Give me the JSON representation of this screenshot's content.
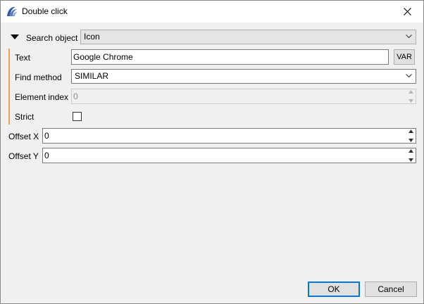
{
  "window": {
    "title": "Double click",
    "icon": "app-logo-icon",
    "close_icon": "close-icon"
  },
  "search_object": {
    "label": "Search object",
    "value": "Icon",
    "toggle_icon": "triangle-down-icon"
  },
  "fields": {
    "text": {
      "label": "Text",
      "value": "Google Chrome",
      "var_label": "VAR"
    },
    "find_method": {
      "label": "Find method",
      "value": "SIMILAR"
    },
    "element_index": {
      "label": "Element index",
      "value": "0"
    },
    "strict": {
      "label": "Strict",
      "checked": false
    }
  },
  "offsets": {
    "x": {
      "label": "Offset X",
      "value": "0"
    },
    "y": {
      "label": "Offset Y",
      "value": "0"
    }
  },
  "buttons": {
    "ok": "OK",
    "cancel": "Cancel"
  },
  "colors": {
    "accent_border": "#0078d7",
    "group_line": "#f0a050",
    "window_bg": "#f0f0f0"
  }
}
